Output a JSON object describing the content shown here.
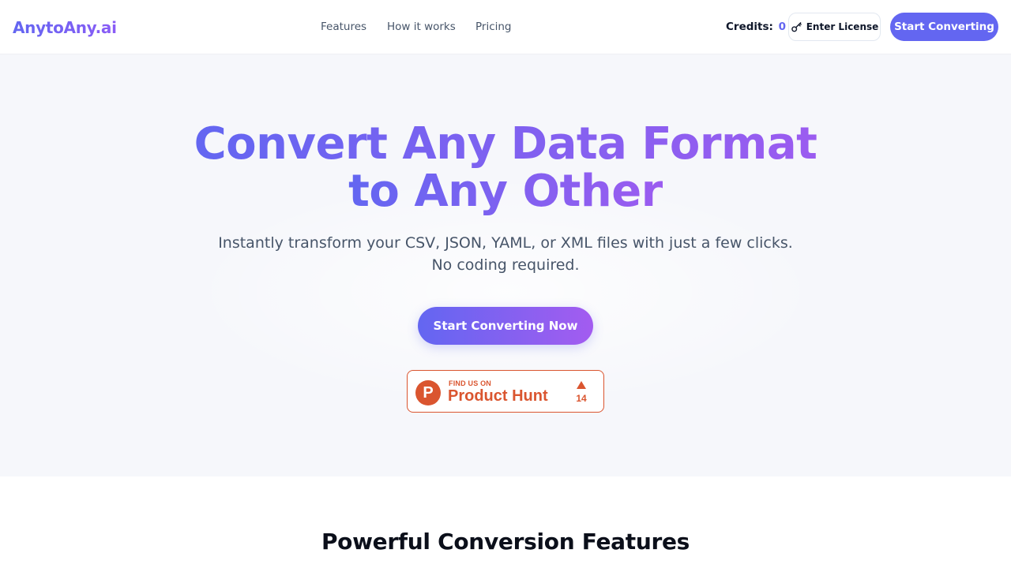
{
  "brand": {
    "logo": "AnytoAny.ai",
    "gradient": [
      "#6366f1",
      "#8b5cf6"
    ]
  },
  "nav": {
    "items": [
      {
        "label": "Features"
      },
      {
        "label": "How it works"
      },
      {
        "label": "Pricing"
      }
    ]
  },
  "header": {
    "credits_label": "Credits:",
    "credits_value": "0",
    "license_button": "Enter License",
    "license_icon": "key-icon",
    "start_button": "Start Converting"
  },
  "hero": {
    "title_line1": "Convert Any Data Format",
    "title_line2": "to Any Other",
    "subtitle_line1": "Instantly transform your CSV, JSON, YAML, or XML files with just a few clicks.",
    "subtitle_line2": "No coding required.",
    "cta": "Start Converting Now",
    "background": "#f6f7fb"
  },
  "product_hunt": {
    "logo_letter": "P",
    "eyebrow": "FIND US ON",
    "name": "Product Hunt",
    "upvote_icon": "triangle-up-icon",
    "votes": "14",
    "color": "#da552f"
  },
  "features": {
    "title": "Powerful Conversion Features"
  },
  "colors": {
    "accent": "#6366f1",
    "accent_end": "#a35cf0",
    "text_muted": "#475569"
  }
}
